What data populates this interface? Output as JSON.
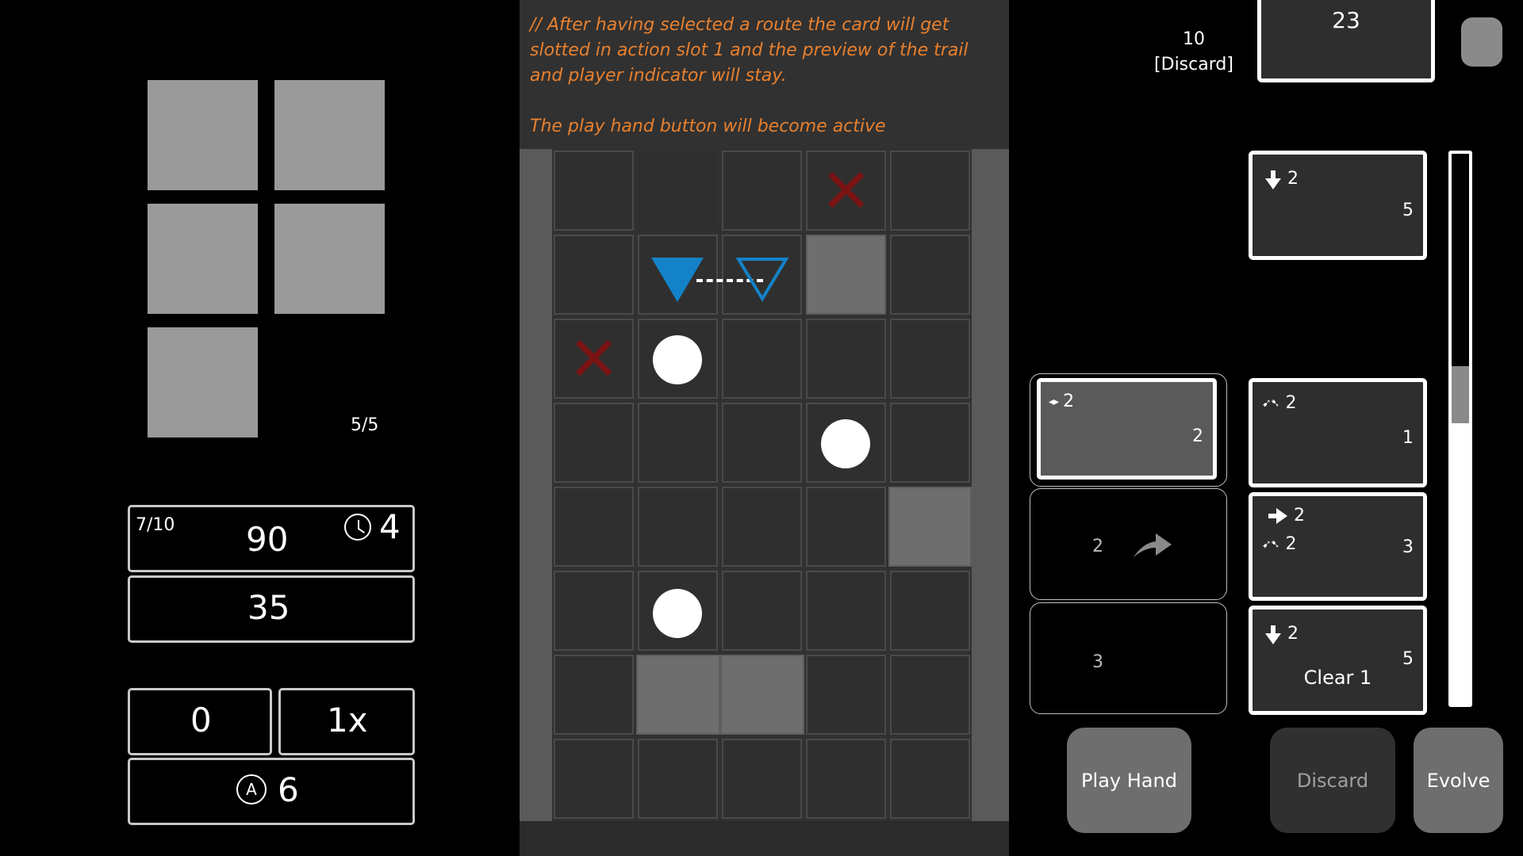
{
  "deck": {
    "count": "5/5"
  },
  "stats": {
    "moves": "7/10",
    "score": "90",
    "timer": "4",
    "target": "35",
    "chips": "0",
    "multiplier": "1x",
    "actions": "6",
    "actions_icon_letter": "A"
  },
  "tutorial": {
    "line1": "// After having selected a route the card will get slotted in action slot 1 and the preview of the trail and player indicator will stay.",
    "line2": "The play hand button will become active"
  },
  "discard": {
    "count": "10",
    "label": "[Discard]"
  },
  "draw_pile": {
    "count": "23"
  },
  "hand": [
    {
      "icon": "down-arrow-icon",
      "moves": "2",
      "cost": "5",
      "extra": ""
    },
    {
      "icon": "diagonal-arrows-icon",
      "moves": "2",
      "cost": "1",
      "extra": ""
    },
    {
      "icon": "right-arrow-icon",
      "moves": "2",
      "icon2": "diagonal-arrows-icon",
      "moves2": "2",
      "cost": "3",
      "extra": ""
    },
    {
      "icon": "down-arrow-icon",
      "moves": "2",
      "cost": "5",
      "extra": "Clear 1"
    }
  ],
  "action_slots": [
    {
      "num": "1",
      "card": {
        "icon": "horizontal-arrows-icon",
        "moves": "2",
        "cost": "2"
      }
    },
    {
      "num": "2",
      "icon": "right-arrow-grey-icon"
    },
    {
      "num": "3"
    }
  ],
  "buttons": {
    "play_hand": "Play Hand",
    "discard": "Discard",
    "evolve": "Evolve"
  },
  "colors": {
    "accent_text": "#e8802e",
    "player": "#1482c8",
    "hazard": "#7a1414"
  }
}
